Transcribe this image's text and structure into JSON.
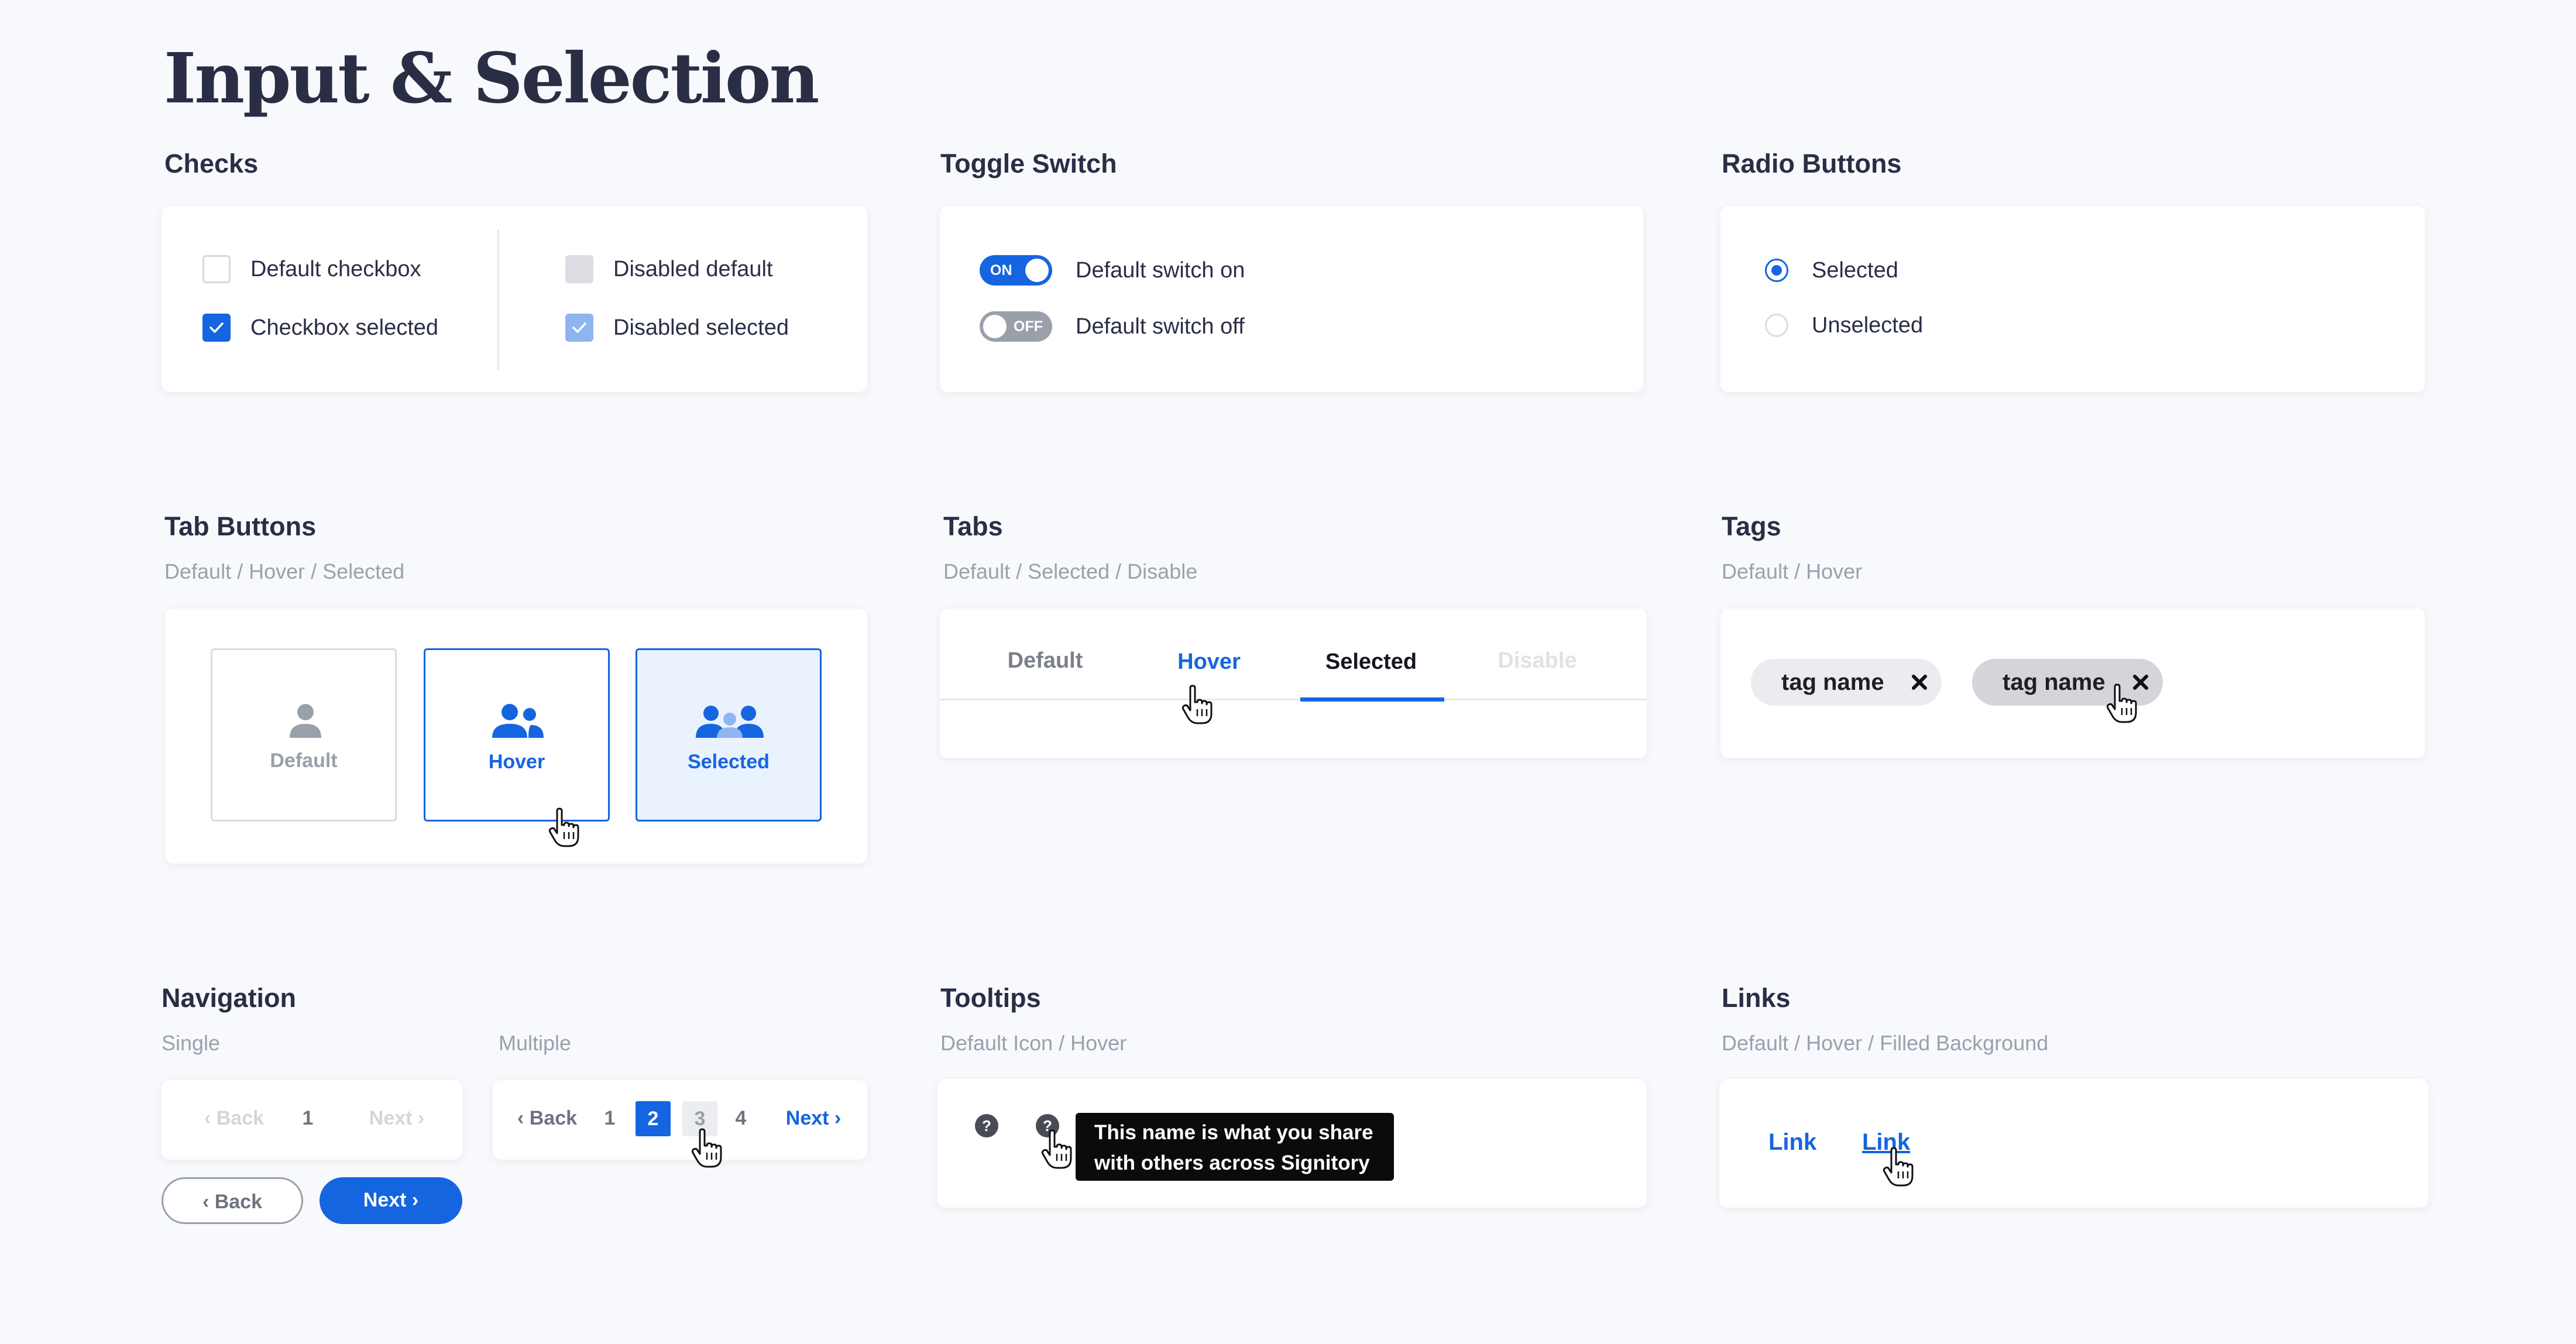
{
  "page": {
    "title": "Input & Selection"
  },
  "checks": {
    "title": "Checks",
    "items": {
      "default": "Default checkbox",
      "selected": "Checkbox selected",
      "disabled_default": "Disabled default",
      "disabled_selected": "Disabled selected"
    }
  },
  "toggle": {
    "title": "Toggle Switch",
    "on_label": "Default switch on",
    "off_label": "Default switch off",
    "on_text": "ON",
    "off_text": "OFF"
  },
  "radio": {
    "title": "Radio Buttons",
    "selected": "Selected",
    "unselected": "Unselected"
  },
  "tab_buttons": {
    "title": "Tab Buttons",
    "subtitle": "Default / Hover / Selected",
    "buttons": [
      "Default",
      "Hover",
      "Selected"
    ]
  },
  "tabs": {
    "title": "Tabs",
    "subtitle": "Default / Selected / Disable",
    "items": [
      "Default",
      "Hover",
      "Selected",
      "Disable"
    ]
  },
  "tags": {
    "title": "Tags",
    "subtitle": "Default / Hover",
    "items": [
      "tag name",
      "tag name"
    ]
  },
  "navigation": {
    "title": "Navigation",
    "single_label": "Single",
    "multiple_label": "Multiple",
    "single": {
      "back": "‹ Back",
      "page": "1",
      "next": "Next ›"
    },
    "multiple": {
      "back": "‹ Back",
      "pages": [
        "1",
        "2",
        "3",
        "4"
      ],
      "next": "Next ›"
    },
    "buttons": {
      "back": "‹ Back",
      "next": "Next ›"
    }
  },
  "tooltips": {
    "title": "Tooltips",
    "subtitle": "Default Icon / Hover",
    "icon_glyph": "?",
    "text_line1": "This name is what you share",
    "text_line2": "with others across Signitory"
  },
  "links": {
    "title": "Links",
    "subtitle": "Default / Hover / Filled Background",
    "default": "Link",
    "hover": "Link"
  },
  "colors": {
    "primary": "#1565e0",
    "text": "#2a2e45",
    "muted": "#9aa0ad",
    "background": "#f8f9fc",
    "card": "#ffffff"
  }
}
